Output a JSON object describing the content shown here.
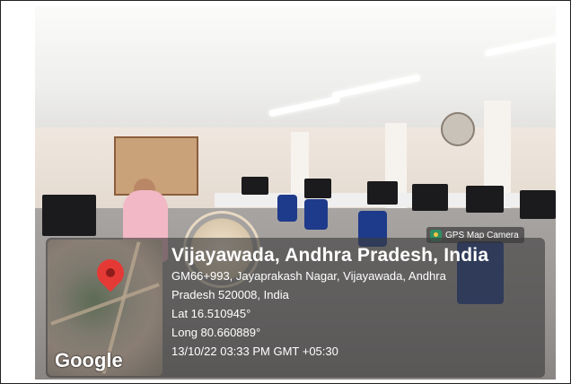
{
  "camera_badge": {
    "label": "GPS Map Camera",
    "icon": "gps-map-camera-icon"
  },
  "location": {
    "title": "Vijayawada, Andhra Pradesh, India",
    "address_line1": "GM66+993, Jayaprakash Nagar, Vijayawada, Andhra",
    "address_line2": "Pradesh 520008, India",
    "latitude": "Lat 16.510945°",
    "longitude": "Long 80.660889°",
    "timestamp": "13/10/22 03:33 PM GMT +05:30"
  },
  "map": {
    "attribution": "Google",
    "pin_icon": "map-pin-icon",
    "pin_color": "#e53935"
  }
}
